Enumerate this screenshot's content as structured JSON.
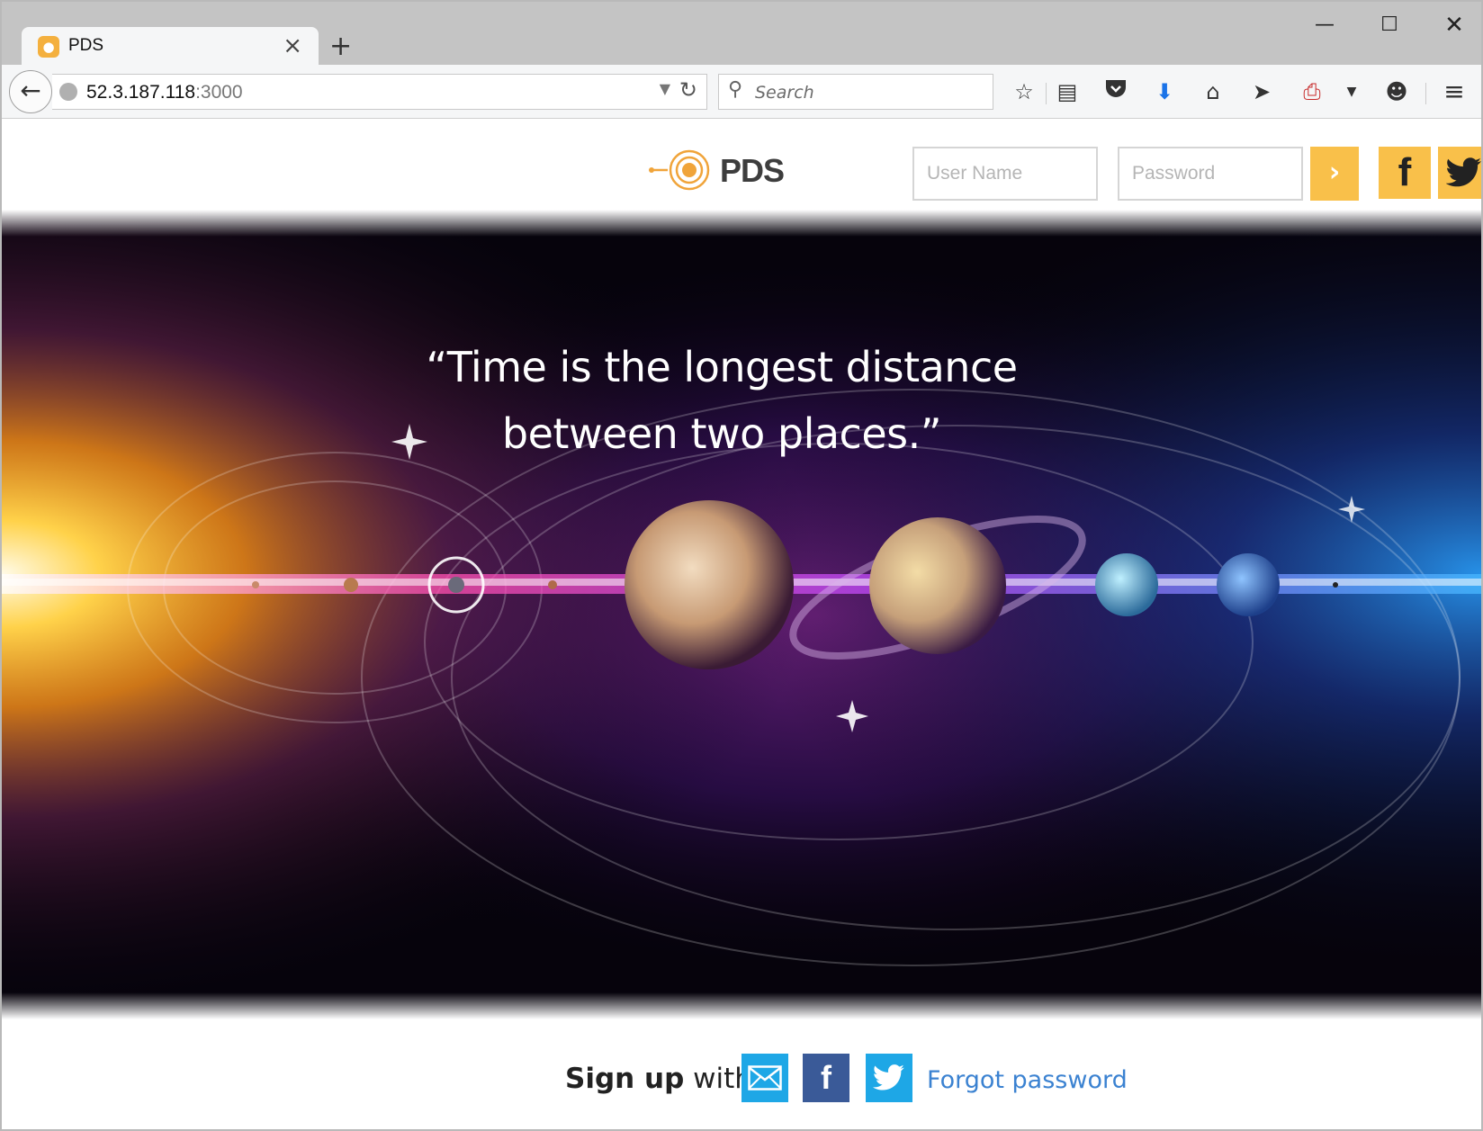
{
  "browser": {
    "tab_title": "PDS",
    "new_tab_label": "+",
    "url_host": "52.3.187.118",
    "url_port": ":3000",
    "search_placeholder": "Search"
  },
  "site": {
    "logo_text": "PDS",
    "username_placeholder": "User Name",
    "password_placeholder": "Password",
    "login_arrow": "›",
    "quote_line1": "“Time is the longest distance",
    "quote_line2": "between two places.”"
  },
  "footer": {
    "signup_bold": "Sign up",
    "signup_rest": " with",
    "forgot_password": "Forgot password"
  },
  "colors": {
    "accent": "#f9c04a",
    "facebook": "#3a5a98",
    "twitter": "#1ea7e6",
    "link": "#3b82d1"
  }
}
